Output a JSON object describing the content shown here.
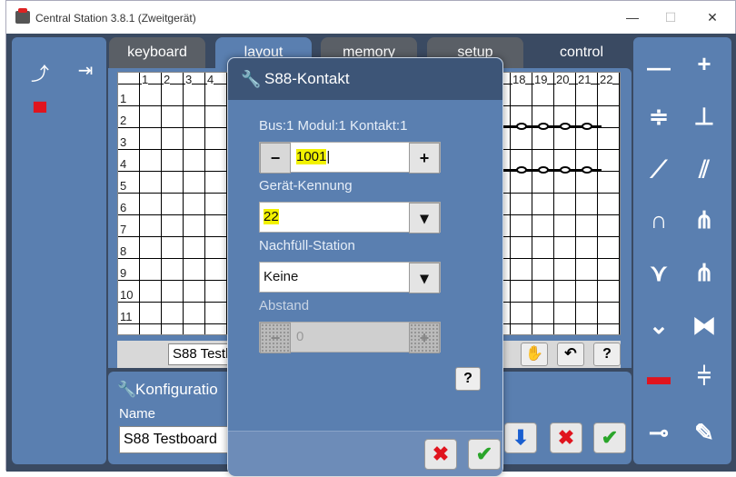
{
  "window": {
    "title": "Central Station 3.8.1 (Zweitgerät)",
    "min": "—",
    "max": "☐",
    "close": "✕"
  },
  "tabs": [
    {
      "label": "keyboard"
    },
    {
      "label": "layout"
    },
    {
      "label": "memory"
    },
    {
      "label": "setup"
    },
    {
      "label": "control"
    }
  ],
  "grid": {
    "rows": [
      "1",
      "2",
      "3",
      "4",
      "5",
      "6",
      "7",
      "8",
      "9",
      "10",
      "11"
    ],
    "cols": [
      "1",
      "2",
      "3",
      "4",
      "18",
      "19",
      "20",
      "21",
      "22"
    ]
  },
  "layout_bottom": {
    "name_value": "S88 Testb",
    "help": "?"
  },
  "config": {
    "title": "Konfiguratio",
    "name_label": "Name",
    "name_value": "S88 Testboard"
  },
  "dialog": {
    "title": "S88-Kontakt",
    "info": "Bus:1 Modul:1 Kontakt:1",
    "address_value": "1001",
    "minus": "−",
    "plus": "+",
    "device_label": "Gerät-Kennung",
    "device_value": "22",
    "refill_label": "Nachfüll-Station",
    "refill_value": "Keine",
    "distance_label": "Abstand",
    "distance_value": "0",
    "help": "?",
    "cancel": "✖",
    "ok": "✔"
  },
  "colors": {
    "panel": "#5a7fb0",
    "dialog_header": "#3d5577",
    "highlight": "#f2f200",
    "cancel": "#e0141e",
    "ok": "#2aa52a"
  }
}
